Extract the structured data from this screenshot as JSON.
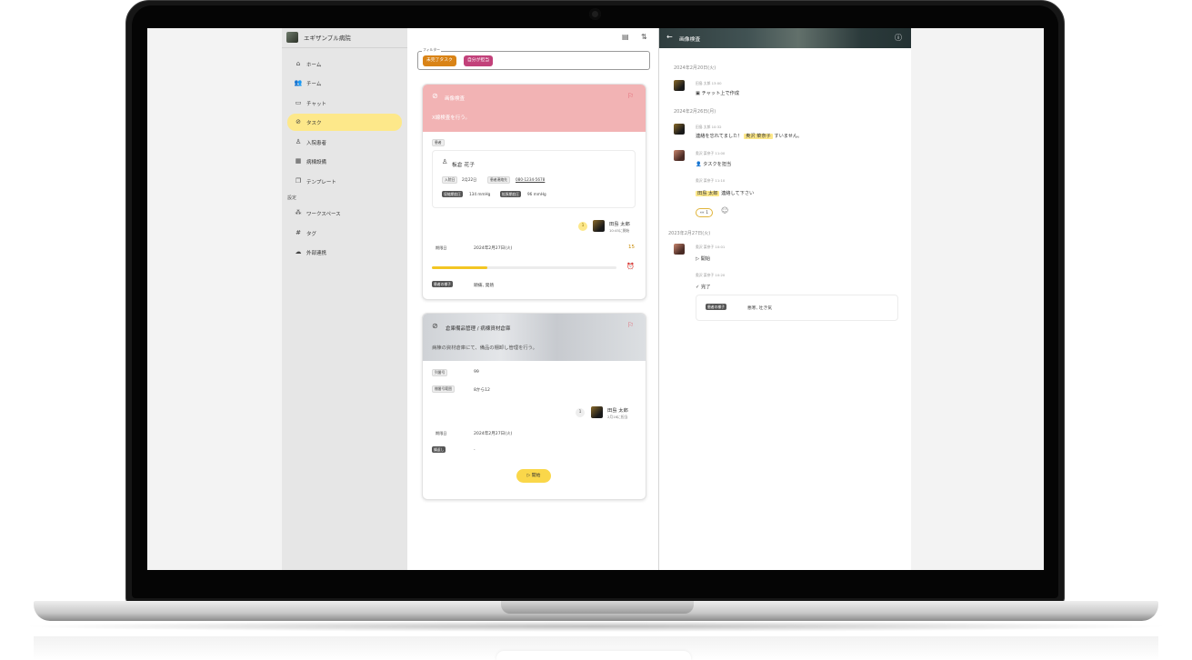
{
  "sidebar": {
    "hospital_name": "エギザンプル病院",
    "nav": [
      {
        "label": "ホーム",
        "icon": "home-icon"
      },
      {
        "label": "チーム",
        "icon": "team-icon"
      },
      {
        "label": "チャット",
        "icon": "chat-icon"
      },
      {
        "label": "タスク",
        "icon": "task-icon",
        "active": true
      },
      {
        "label": "入院患者",
        "icon": "patient-icon"
      },
      {
        "label": "病棟設備",
        "icon": "ward-icon"
      },
      {
        "label": "テンプレート",
        "icon": "template-icon"
      }
    ],
    "settings_label": "設定",
    "settings_nav": [
      {
        "label": "ワークスペース",
        "icon": "workspace-icon"
      },
      {
        "label": "タグ",
        "icon": "hash-icon"
      },
      {
        "label": "外部連携",
        "icon": "cloud-icon"
      }
    ]
  },
  "filter": {
    "legend": "フィルター",
    "chips": [
      {
        "label": "未完了タスク",
        "color": "#d98316"
      },
      {
        "label": "自分が担当",
        "color": "#c2417a"
      }
    ]
  },
  "task1": {
    "title": "画像検査",
    "description": "X線検査を行う。",
    "patient_tag": "患者",
    "patient_name": "板倉 花子",
    "admission_label": "入院日",
    "admission_value": "2月22日",
    "contact_label": "患者連絡先",
    "contact_value": "080-1234-5678",
    "sbp_label": "収縮期血圧",
    "sbp_value": "134 mmHg",
    "dbp_label": "拡張期血圧",
    "dbp_value": "96 mmHg",
    "assignee_count": "1",
    "assignee_name": "田島 太郎",
    "assignee_time": "10:45に開始",
    "deadline_label": "期限日",
    "deadline_value": "2024年2月27日(火)",
    "deadline_count": "15",
    "progress": 0.3,
    "condition_label": "患者の様子",
    "condition_value": "頭痛, 発熱"
  },
  "task2": {
    "title": "倉庫備品管理 / 病棟資材倉庫",
    "description": "病棟の資材倉庫にて、備品の棚卸し管理を行う。",
    "shelf_label": "列番号",
    "shelf_value": "99",
    "range_label": "棚番号範囲",
    "range_value": "8から12",
    "assignee_count": "1",
    "assignee_name": "田島 太郎",
    "assignee_time": "2月16に担当",
    "deadline_label": "期限日",
    "deadline_value": "2024年2月27日(火)",
    "repeat_label": "繰返し",
    "repeat_value": "-",
    "start_button": "開始"
  },
  "chat": {
    "title": "画像検査",
    "messages": [
      {
        "date": "2024年2月20日(火)"
      },
      {
        "meta": "田島 太郎  13:00",
        "text": "チャット上で作成"
      },
      {
        "date": "2024年2月26日(月)"
      },
      {
        "meta": "田島 太郎  10:32",
        "text_pre": "連絡を忘れてました！",
        "mention": "奥沢 菜奈子",
        "text_post": "すいません。"
      },
      {
        "meta": "奥沢 菜奈子  11:00",
        "text": "タスクを担当"
      },
      {
        "meta": "奥沢 菜奈子  11:10",
        "mention": "田島 太郎",
        "text_post": "連絡して下さい"
      },
      {
        "reaction": "👀 1"
      },
      {
        "date": "2023年2月27日(火)"
      },
      {
        "meta": "奥沢 菜奈子  10:01",
        "text": "開始"
      },
      {
        "meta": "奥沢 菜奈子  10:20",
        "text": "完了"
      },
      {
        "condition_label": "患者の様子",
        "condition_value": "悪寒, 吐き気"
      }
    ]
  }
}
